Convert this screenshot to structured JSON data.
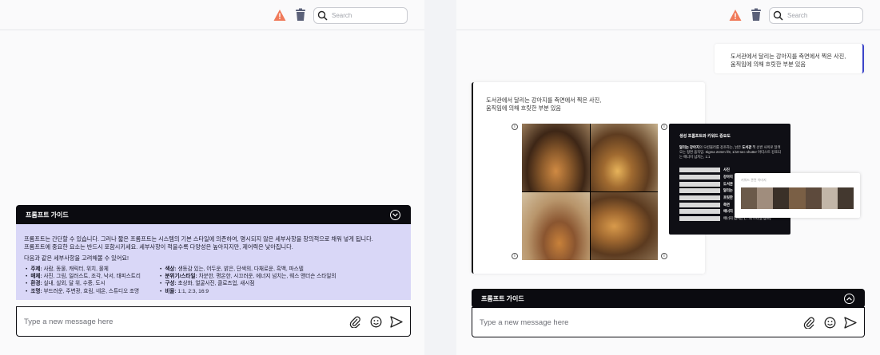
{
  "search": {
    "placeholder": "Search"
  },
  "guide": {
    "title": "프롬프트 가이드",
    "intro_line1": "프롬프트는 간단할 수 있습니다. 그러나 짧은 프롬프트는 시스템의 기본 스타일에 의존하여, 명시되지 않은 세부사항을 창의적으로 채워 넣게 됩니다.",
    "intro_line2": "프롬프트에 중요한 요소는 반드시 포함시키세요. 세부사항이 적을수록 다양성은 높아지지만, 제어력은 낮아집니다.",
    "consider": "다음과 같은 세부사항을 고려해볼 수 있어요!",
    "left_items": [
      {
        "key": "주제:",
        "val": " 사람, 동물, 캐릭터, 위치, 물체"
      },
      {
        "key": "매체:",
        "val": " 사진, 그림, 일러스트, 조각, 낙서, 태피스트리"
      },
      {
        "key": "환경:",
        "val": " 실내, 실외, 달 위, 수중, 도시"
      },
      {
        "key": "조명:",
        "val": " 부드러운, 주변광, 흐림, 네온, 스튜디오 조명"
      }
    ],
    "right_items": [
      {
        "key": "색상:",
        "val": " 생동감 있는, 어두운, 밝은, 단색의, 다채로운, 흑백, 파스텔"
      },
      {
        "key": "분위기/스타일:",
        "val": " 차분한, 평온한, 시끄러운, 에너지 넘치는, 웨스 앤더슨 스타일의"
      },
      {
        "key": "구성:",
        "val": " 초상화, 얼굴사진, 클로즈업, 새시점"
      },
      {
        "key": "비율:",
        "val": " 1:1, 2:3, 16:9"
      }
    ]
  },
  "composer": {
    "placeholder": "Type a new message here"
  },
  "chat": {
    "user_line1": "도서관에서 달리는 강아지를 측면에서 찍은 사진,",
    "user_line2": "움직임에 의해 흐릿한 부분 있음",
    "bot_line1": "도서관에서 달리는 강아지를 측면에서 찍은 사진,",
    "bot_line2": "움직임에 의해 흐릿한 부분 있음"
  },
  "tooltip": {
    "title": "생성 프롬프트와 키워드 중요도",
    "desc_bold1": "달리는 강아지",
    "desc_mid1": "의 모션블러를 강조하는, 낡은 ",
    "desc_bold2": "도서관",
    "desc_mid2": " 책 선반 사이로 달려오는 정면 움직임. Sigma 24mm f/8, 1/10-sec shutter 아티스트 강조되는 에너지 넘치는, 1:1",
    "rows": [
      {
        "key": "사진"
      },
      {
        "key": "강아지"
      },
      {
        "key": "도서관"
      },
      {
        "key": "달리는"
      },
      {
        "key": "흐릿한"
      },
      {
        "key": "측면"
      },
      {
        "key": "에너지"
      },
      {
        "key": "",
        "tail": "에너지 넘치는 (…의 스타일 참조)"
      }
    ]
  },
  "popover": {
    "title": "키워드 관련 이미지"
  }
}
